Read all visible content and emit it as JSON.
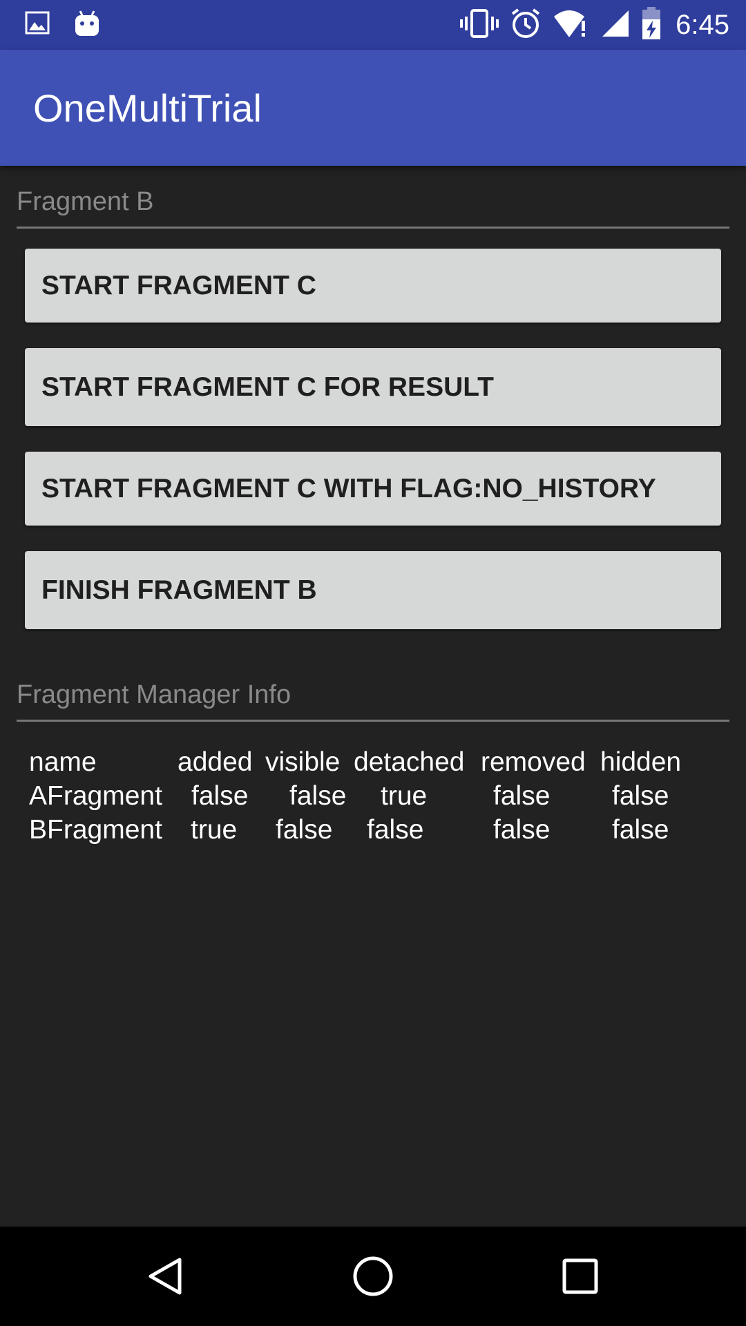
{
  "status_bar": {
    "icons_left": [
      "image-icon",
      "android-icon"
    ],
    "icons_right": [
      "vibrate-icon",
      "alarm-icon",
      "wifi-alert-icon",
      "cell-signal-icon",
      "battery-charging-icon"
    ],
    "time": "6:45"
  },
  "app_bar": {
    "title": "OneMultiTrial"
  },
  "fragment_section": {
    "header": "Fragment B",
    "buttons": [
      {
        "label": "START FRAGMENT C"
      },
      {
        "label": "START FRAGMENT C FOR RESULT"
      },
      {
        "label": "START FRAGMENT C WITH FLAG:NO_HISTORY"
      },
      {
        "label": "FINISH FRAGMENT B"
      }
    ]
  },
  "fragment_manager_section": {
    "header": "Fragment Manager Info",
    "columns": [
      "name",
      "added",
      "visible",
      "detached",
      "removed",
      "hidden"
    ],
    "rows": [
      [
        "AFragment",
        "false",
        "false",
        "true",
        "false",
        "false"
      ],
      [
        "BFragment",
        "true",
        "false",
        "false",
        "false",
        "false"
      ]
    ]
  },
  "nav_bar": {
    "buttons": [
      "back-icon",
      "home-icon",
      "recents-icon"
    ]
  },
  "colors": {
    "status_bar": "#2f3d9c",
    "app_bar": "#3f51b5",
    "background": "#222222",
    "button_bg": "#d6d7d7",
    "header_text": "#8a8a8a"
  }
}
